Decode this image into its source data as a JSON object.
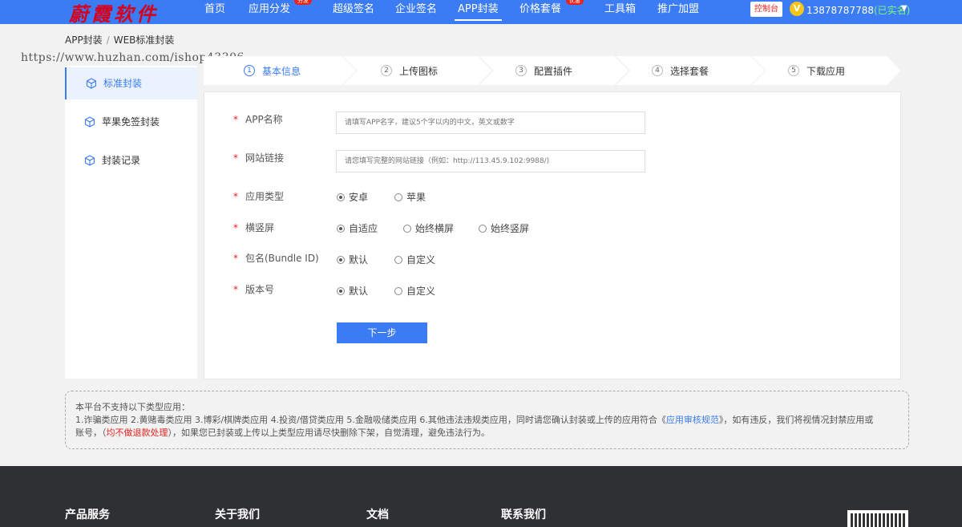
{
  "header": {
    "logo": "蔚霞软件",
    "nav": [
      {
        "label": "首页",
        "badge": ""
      },
      {
        "label": "应用分发",
        "badge": "分发"
      },
      {
        "label": "超级签名",
        "badge": ""
      },
      {
        "label": "企业签名",
        "badge": ""
      },
      {
        "label": "APP封装",
        "badge": ""
      },
      {
        "label": "价格套餐",
        "badge": "优惠"
      },
      {
        "label": "工具箱",
        "badge": ""
      },
      {
        "label": "推广加盟",
        "badge": ""
      }
    ],
    "console_label": "控制台",
    "vip_badge": "V",
    "phone": "13878787788",
    "verified": "(已实名)"
  },
  "breadcrumb": {
    "root": "APP封装",
    "separator": "/",
    "current": "WEB标准封装"
  },
  "watermark": "https://www.huzhan.com/ishop43306",
  "sidebar": {
    "items": [
      {
        "label": "标准封装",
        "icon": "cube-icon"
      },
      {
        "label": "苹果免签封装",
        "icon": "cube-icon"
      },
      {
        "label": "封装记录",
        "icon": "cube-icon"
      }
    ]
  },
  "steps": [
    {
      "num": "1",
      "label": "基本信息"
    },
    {
      "num": "2",
      "label": "上传图标"
    },
    {
      "num": "3",
      "label": "配置插件"
    },
    {
      "num": "4",
      "label": "选择套餐"
    },
    {
      "num": "5",
      "label": "下载应用"
    }
  ],
  "form": {
    "required_mark": "*",
    "app_name": {
      "label": "APP名称",
      "placeholder": "请填写APP名字，建议5个字以内的中文，英文或数字"
    },
    "site_url": {
      "label": "网站链接",
      "placeholder": "请您填写完整的网站链接（例如：http://113.45.9.102:9988/)"
    },
    "app_type": {
      "label": "应用类型",
      "options": [
        "安卓",
        "苹果"
      ],
      "selected": "安卓"
    },
    "orientation": {
      "label": "横竖屏",
      "options": [
        "自适应",
        "始终横屏",
        "始终竖屏"
      ],
      "selected": "自适应"
    },
    "bundle_id": {
      "label": "包名(Bundle ID)",
      "options": [
        "默认",
        "自定义"
      ],
      "selected": "默认"
    },
    "version": {
      "label": "版本号",
      "options": [
        "默认",
        "自定义"
      ],
      "selected": "默认"
    },
    "next_label": "下一步"
  },
  "notice": {
    "line1": "本平台不支持以下类型应用：",
    "line2_a": "1.诈骗类应用 2.黄赌毒类应用 3.博彩/棋牌类应用 4.投资/借贷类应用 5.金融吸储类应用 6.其他违法违规类应用，同时请您确认封装或上传的应用符合《",
    "line2_link": "应用审核规范",
    "line2_b": "》，如有违反，我们将视情况封禁应用或",
    "line3_a": "账号，（",
    "line3_red": "均不做退款处理",
    "line3_b": "），如果您已封装或上传以上类型应用请尽快删除下架，自觉清理，避免违法行为。"
  },
  "footer": {
    "columns": [
      "产品服务",
      "关于我们",
      "文档",
      "联系我们"
    ]
  },
  "colors": {
    "primary": "#3b7cf5",
    "danger": "#e8231f",
    "footer_bg": "#2f3033"
  }
}
